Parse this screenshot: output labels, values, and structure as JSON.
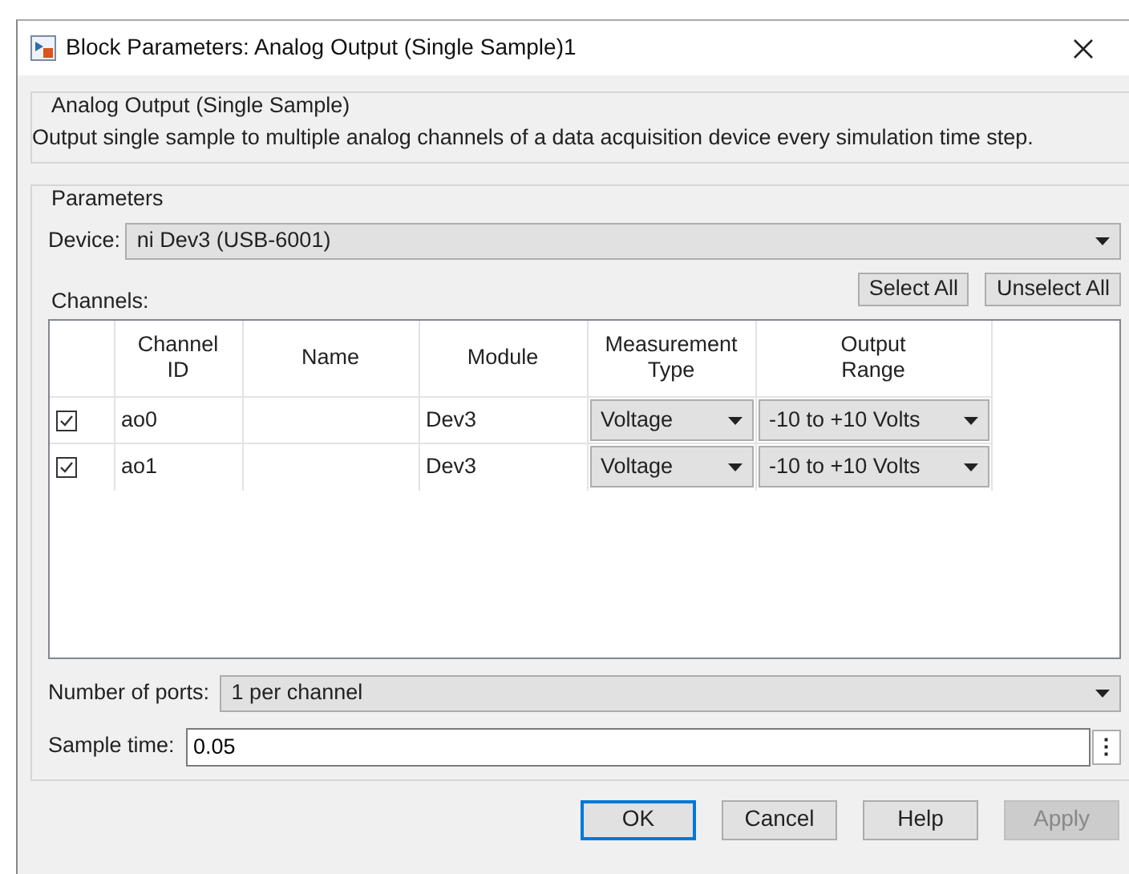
{
  "window": {
    "title": "Block Parameters: Analog Output (Single Sample)1"
  },
  "description_group": {
    "title": "Analog Output (Single Sample)",
    "text": "Output single sample to multiple analog channels of a data acquisition device every simulation time step."
  },
  "parameters": {
    "title": "Parameters",
    "device": {
      "label": "Device:",
      "value": "ni Dev3 (USB-6001)"
    },
    "channels_label": "Channels:",
    "channel_buttons": [
      {
        "label": "Select All"
      },
      {
        "label": "Unselect All"
      }
    ],
    "table": {
      "columns": [
        "",
        "Channel\nID",
        "Name",
        "Module",
        "Measurement\nType",
        "Output\nRange"
      ],
      "rows": [
        {
          "checked": true,
          "channel_id": "ao0",
          "name": "",
          "module": "Dev3",
          "measurement_type": "Voltage",
          "output_range": "-10 to +10 Volts"
        },
        {
          "checked": true,
          "channel_id": "ao1",
          "name": "",
          "module": "Dev3",
          "measurement_type": "Voltage",
          "output_range": "-10 to +10 Volts"
        }
      ]
    },
    "number_of_ports": {
      "label": "Number of ports:",
      "value": "1 per channel"
    },
    "sample_time": {
      "label": "Sample time:",
      "value": "0.05",
      "menu_glyph": "⋮"
    }
  },
  "buttons": [
    {
      "label": "OK",
      "disabled": false,
      "default": true
    },
    {
      "label": "Cancel",
      "disabled": false,
      "default": false
    },
    {
      "label": "Help",
      "disabled": false,
      "default": false
    },
    {
      "label": "Apply",
      "disabled": true,
      "default": false
    }
  ]
}
